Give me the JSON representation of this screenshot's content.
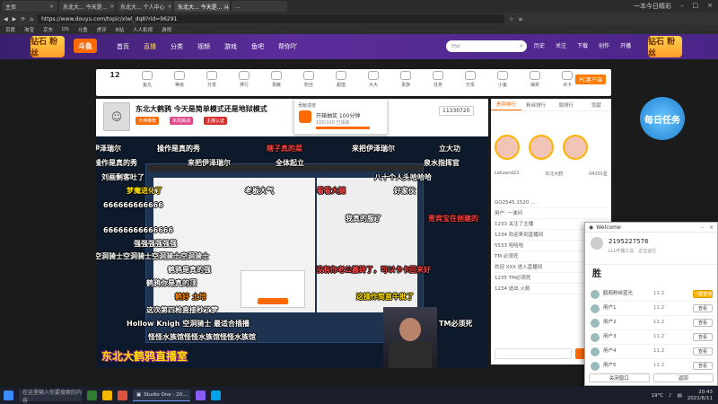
{
  "browser": {
    "tabs": [
      {
        "label": "主页",
        "active": false
      },
      {
        "label": "东北大... 今天是...",
        "active": false
      },
      {
        "label": "东北大... 个人中心",
        "active": false
      },
      {
        "label": "东北大... 今天是... 斗鱼",
        "active": true
      },
      {
        "label": "... ",
        "active": false
      }
    ],
    "window_title": "一本今日精彩",
    "url": "https://www.douyu.com/topic/xlwl_dq8?rid=96291",
    "bookmarks": [
      "百度",
      "淘宝",
      "京东",
      "DS",
      "斗鱼",
      "虎牙",
      "B站",
      "人人影视",
      "游戏"
    ]
  },
  "site": {
    "banner_left": "钻石 粉丝",
    "banner_right": "钻石 粉丝",
    "logo": "斗鱼",
    "nav": [
      {
        "label": "首页",
        "active": false
      },
      {
        "label": "直播",
        "active": true
      },
      {
        "label": "分类",
        "active": false
      },
      {
        "label": "视频",
        "active": false
      },
      {
        "label": "游戏",
        "active": false
      },
      {
        "label": "鱼吧",
        "active": false
      },
      {
        "label": "帮你吖",
        "active": false
      }
    ],
    "search_placeholder": "mo",
    "header_icons": [
      "历史",
      "关注",
      "下载",
      "创作",
      "开播"
    ]
  },
  "room_toolbar": {
    "level": "12",
    "items": [
      "鱼丸",
      "等级",
      "分享",
      "排行",
      "贡献",
      "粉丝",
      "超值",
      "大大",
      "贵族",
      "任务",
      "分享",
      "小鱼",
      "抽奖",
      "点卡",
      "游戏",
      "更多"
    ],
    "pc_button": "PC客户端",
    "pc_sub": "下载此直播间"
  },
  "streamer": {
    "title": "东北大鹤鸦 今天是简单模式还是地狱模式",
    "tags": [
      "大神推荐",
      "本周挑战",
      "主播认证"
    ],
    "follow_count": "11330720"
  },
  "gift_popup": {
    "title": "贡献进度",
    "line1": "开箱抽奖 100分钟",
    "line2": "100/100 已领取",
    "progress": 1.0
  },
  "right_panel": {
    "tabs": [
      "贵宾排行",
      "粉丝排行",
      "周排行",
      "贡献"
    ],
    "top_names": [
      "Lakuand22",
      "东北大鹤",
      "04201星"
    ],
    "list": [
      "GO2545.1520 ...",
      "用户: 一波问",
      "1233 关注了主播",
      "1234 欢迎来到直播间",
      "5533 哈哈哈",
      "TM 必须死",
      "欢迎 XXX 进入直播间",
      "1235 TM必须死",
      "1234 送出 火箭"
    ],
    "task_badge": "每日任务"
  },
  "danmu": [
    {
      "text": "伊泽瑞尔",
      "color": "#ffffff"
    },
    {
      "text": "操作是真的秀",
      "color": "#ffffff"
    },
    {
      "text": "瞎子真的菜",
      "color": "#ff4444"
    },
    {
      "text": "来把伊泽瑞尔",
      "color": "#ffffff"
    },
    {
      "text": "立大功",
      "color": "#ffffff"
    },
    {
      "text": "操作是真的秀",
      "color": "#ffffff"
    },
    {
      "text": "来把伊泽瑞尔",
      "color": "#ffffff"
    },
    {
      "text": "全体起立",
      "color": "#ffffff"
    },
    {
      "text": "泉水指挥官",
      "color": "#ffffff"
    },
    {
      "text": "刘画剩客吐了",
      "color": "#ffffff"
    },
    {
      "text": "八十个人头哈哈哈",
      "color": "#ffffff"
    },
    {
      "text": "梦魔进化了",
      "color": "#ffe100"
    },
    {
      "text": "老板大气",
      "color": "#ffffff"
    },
    {
      "text": "看看大腿",
      "color": "#ff4444"
    },
    {
      "text": "好家伙",
      "color": "#ffffff"
    },
    {
      "text": "666666666666",
      "color": "#ffffff"
    },
    {
      "text": "我真的服了",
      "color": "#ffffff"
    },
    {
      "text": "贵宾宝在创建的",
      "color": "#ff4444"
    },
    {
      "text": "66666666666666",
      "color": "#ffffff"
    },
    {
      "text": "强强强强强强",
      "color": "#ffffff"
    },
    {
      "text": "空洞骑士空洞骑士空洞骑士空洞骑士",
      "color": "#ffffff"
    },
    {
      "text": "鹤鸦是真的强",
      "color": "#ffffff"
    },
    {
      "text": "没有你老公搬砖了，可以卡卡回来好",
      "color": "#ff4444"
    },
    {
      "text": "鹤鸦你是真的顶",
      "color": "#ffffff"
    },
    {
      "text": "鹤好 土培",
      "color": "#ff8800"
    },
    {
      "text": "这操作简直牛批了",
      "color": "#ffe100"
    },
    {
      "text": "这次第四枪直接秒了梦",
      "color": "#ffffff"
    },
    {
      "text": "Hollow Knigh 空洞骑士 最适合插播",
      "color": "#ffffff"
    },
    {
      "text": "怪怪水族馆怪怪水族馆怪怪水族馆",
      "color": "#ffffff"
    },
    {
      "text": "TM必须死",
      "color": "#ffffff"
    }
  ],
  "video_promo": "东北大鹤鸦直播室",
  "welcome": {
    "title": "Welcome",
    "uid": "2195227576",
    "sub": "LLL开播工具 · 正在运行",
    "big": "胜",
    "rows": [
      {
        "name": "鹤鸦粉丝蓝光",
        "value": "11.2",
        "btn": "一键查询",
        "hi": true
      },
      {
        "name": "用户1",
        "value": "11.2",
        "btn": "查看",
        "hi": false
      },
      {
        "name": "用户2",
        "value": "11.2",
        "btn": "查看",
        "hi": false
      },
      {
        "name": "用户3",
        "value": "11.2",
        "btn": "查看",
        "hi": false
      },
      {
        "name": "用户4",
        "value": "11.2",
        "btn": "查看",
        "hi": false
      },
      {
        "name": "用户5",
        "value": "11.2",
        "btn": "查看",
        "hi": false
      }
    ],
    "footer": [
      "关闭窗口",
      "返回"
    ]
  },
  "taskbar": {
    "search": "在这里输入你要搜索的内容",
    "apps": [
      "Studio One - 20..."
    ],
    "temp": "19°C",
    "time": "20:43",
    "date": "2021/6/11"
  }
}
